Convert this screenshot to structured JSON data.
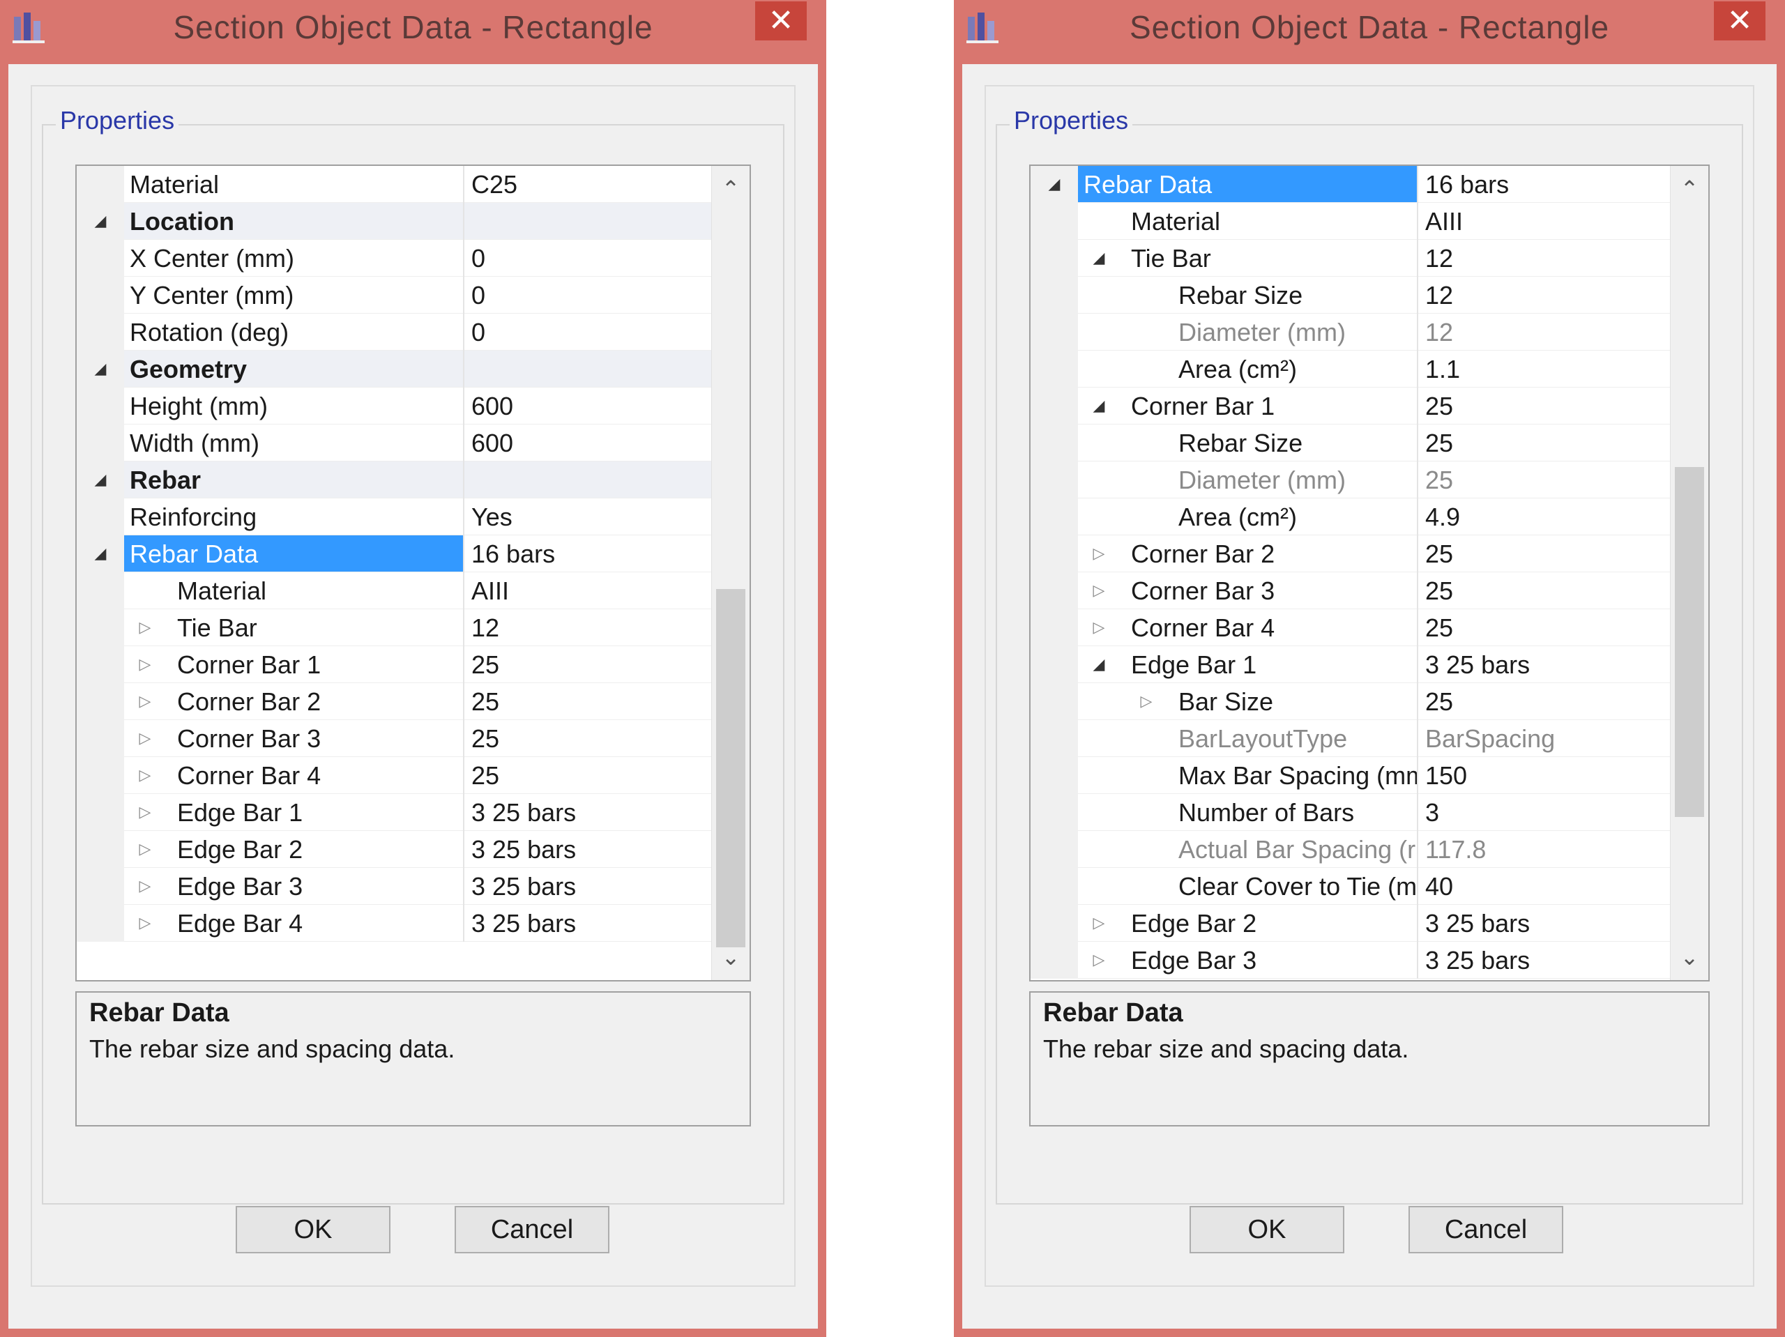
{
  "left_dialog": {
    "title": "Section Object Data - Rectangle",
    "close_glyph": "✕",
    "group_label": "Properties",
    "rows": [
      {
        "name": "Material",
        "value": "C25",
        "level": 1,
        "kind": "prop",
        "expander": "none"
      },
      {
        "name": "Location",
        "value": "",
        "level": 1,
        "kind": "category",
        "expander": "expanded"
      },
      {
        "name": "X Center (mm)",
        "value": "0",
        "level": 1,
        "kind": "prop",
        "expander": "none"
      },
      {
        "name": "Y Center (mm)",
        "value": "0",
        "level": 1,
        "kind": "prop",
        "expander": "none"
      },
      {
        "name": "Rotation (deg)",
        "value": "0",
        "level": 1,
        "kind": "prop",
        "expander": "none"
      },
      {
        "name": "Geometry",
        "value": "",
        "level": 1,
        "kind": "category",
        "expander": "expanded"
      },
      {
        "name": "Height (mm)",
        "value": "600",
        "level": 1,
        "kind": "prop",
        "expander": "none"
      },
      {
        "name": "Width (mm)",
        "value": "600",
        "level": 1,
        "kind": "prop",
        "expander": "none"
      },
      {
        "name": "Rebar",
        "value": "",
        "level": 1,
        "kind": "category",
        "expander": "expanded"
      },
      {
        "name": "Reinforcing",
        "value": "Yes",
        "level": 1,
        "kind": "prop",
        "expander": "none"
      },
      {
        "name": "Rebar Data",
        "value": "16 bars",
        "level": 1,
        "kind": "selected",
        "expander": "expanded"
      },
      {
        "name": "Material",
        "value": "AIII",
        "level": 2,
        "kind": "prop",
        "expander": "none"
      },
      {
        "name": "Tie Bar",
        "value": "12",
        "level": 2,
        "kind": "prop",
        "expander": "collapsed"
      },
      {
        "name": "Corner Bar 1",
        "value": "25",
        "level": 2,
        "kind": "prop",
        "expander": "collapsed"
      },
      {
        "name": "Corner Bar 2",
        "value": "25",
        "level": 2,
        "kind": "prop",
        "expander": "collapsed"
      },
      {
        "name": "Corner Bar 3",
        "value": "25",
        "level": 2,
        "kind": "prop",
        "expander": "collapsed"
      },
      {
        "name": "Corner Bar 4",
        "value": "25",
        "level": 2,
        "kind": "prop",
        "expander": "collapsed"
      },
      {
        "name": "Edge Bar 1",
        "value": "3 25 bars",
        "level": 2,
        "kind": "prop",
        "expander": "collapsed"
      },
      {
        "name": "Edge Bar 2",
        "value": "3 25 bars",
        "level": 2,
        "kind": "prop",
        "expander": "collapsed"
      },
      {
        "name": "Edge Bar 3",
        "value": "3 25 bars",
        "level": 2,
        "kind": "prop",
        "expander": "collapsed"
      },
      {
        "name": "Edge Bar 4",
        "value": "3 25 bars",
        "level": 2,
        "kind": "prop",
        "expander": "collapsed"
      }
    ],
    "description": {
      "title": "Rebar Data",
      "body": "The rebar size and spacing data."
    },
    "scroll": {
      "up": "⌃",
      "down": "⌄",
      "thumb_start": 0.52,
      "thumb_end": 0.96
    },
    "buttons": {
      "ok": "OK",
      "cancel": "Cancel"
    }
  },
  "right_dialog": {
    "title": "Section Object Data - Rectangle",
    "close_glyph": "✕",
    "group_label": "Properties",
    "rows": [
      {
        "name": "Rebar Data",
        "value": "16 bars",
        "level": 1,
        "kind": "selected",
        "expander": "expanded"
      },
      {
        "name": "Material",
        "value": "AIII",
        "level": 2,
        "kind": "prop",
        "expander": "none"
      },
      {
        "name": "Tie Bar",
        "value": "12",
        "level": 2,
        "kind": "prop",
        "expander": "expanded"
      },
      {
        "name": "Rebar Size",
        "value": "12",
        "level": 3,
        "kind": "prop",
        "expander": "none"
      },
      {
        "name": "Diameter (mm)",
        "value": "12",
        "level": 3,
        "kind": "readonly",
        "expander": "none"
      },
      {
        "name": "Area (cm²)",
        "value": "1.1",
        "level": 3,
        "kind": "prop",
        "expander": "none"
      },
      {
        "name": "Corner Bar 1",
        "value": "25",
        "level": 2,
        "kind": "prop",
        "expander": "expanded"
      },
      {
        "name": "Rebar Size",
        "value": "25",
        "level": 3,
        "kind": "prop",
        "expander": "none"
      },
      {
        "name": "Diameter (mm)",
        "value": "25",
        "level": 3,
        "kind": "readonly",
        "expander": "none"
      },
      {
        "name": "Area (cm²)",
        "value": "4.9",
        "level": 3,
        "kind": "prop",
        "expander": "none"
      },
      {
        "name": "Corner Bar 2",
        "value": "25",
        "level": 2,
        "kind": "prop",
        "expander": "collapsed"
      },
      {
        "name": "Corner Bar 3",
        "value": "25",
        "level": 2,
        "kind": "prop",
        "expander": "collapsed"
      },
      {
        "name": "Corner Bar 4",
        "value": "25",
        "level": 2,
        "kind": "prop",
        "expander": "collapsed"
      },
      {
        "name": "Edge Bar 1",
        "value": "3 25 bars",
        "level": 2,
        "kind": "prop",
        "expander": "expanded"
      },
      {
        "name": "Bar Size",
        "value": "25",
        "level": 3,
        "kind": "prop",
        "expander": "collapsed"
      },
      {
        "name": "BarLayoutType",
        "value": "BarSpacing",
        "level": 3,
        "kind": "readonly",
        "expander": "none"
      },
      {
        "name": "Max Bar Spacing (mm",
        "value": "150",
        "level": 3,
        "kind": "prop",
        "expander": "none"
      },
      {
        "name": "Number of Bars",
        "value": "3",
        "level": 3,
        "kind": "prop",
        "expander": "none"
      },
      {
        "name": "Actual Bar Spacing (r",
        "value": "117.8",
        "level": 3,
        "kind": "readonly",
        "expander": "none"
      },
      {
        "name": "Clear Cover to Tie (m",
        "value": "40",
        "level": 3,
        "kind": "prop",
        "expander": "none"
      },
      {
        "name": "Edge Bar 2",
        "value": "3 25 bars",
        "level": 2,
        "kind": "prop",
        "expander": "collapsed"
      },
      {
        "name": "Edge Bar 3",
        "value": "3 25 bars",
        "level": 2,
        "kind": "prop",
        "expander": "collapsed"
      }
    ],
    "description": {
      "title": "Rebar Data",
      "body": "The rebar size and spacing data."
    },
    "scroll": {
      "up": "⌃",
      "down": "⌄",
      "thumb_start": 0.37,
      "thumb_end": 0.8
    },
    "buttons": {
      "ok": "OK",
      "cancel": "Cancel"
    }
  },
  "colors": {
    "title_bar": "#d9766f",
    "close_button": "#c7453b",
    "selection": "#3399ff",
    "group_label": "#2a38a8"
  }
}
